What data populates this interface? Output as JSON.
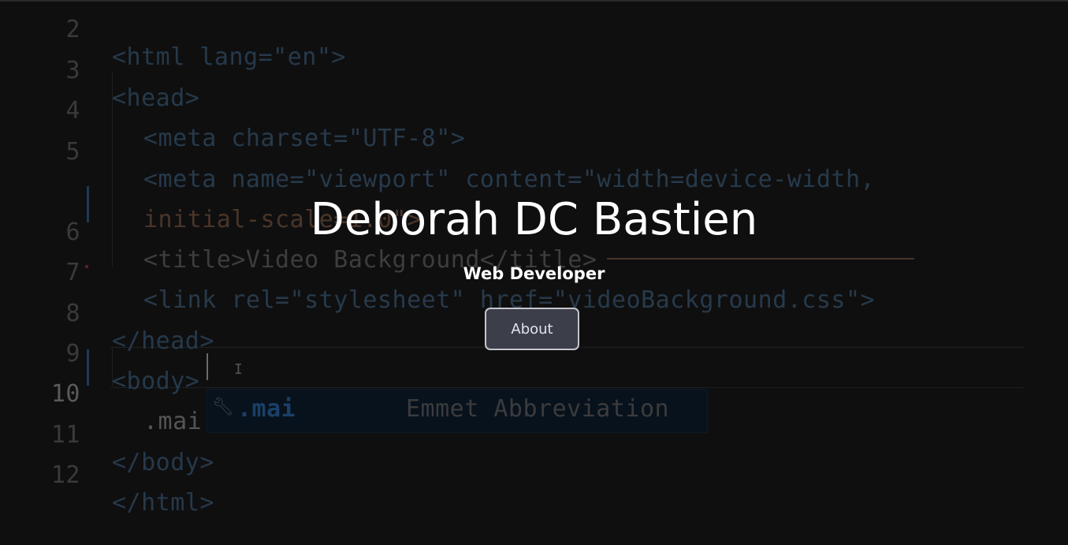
{
  "hero": {
    "title": "Deborah DC Bastien",
    "subtitle": "Web Developer",
    "button_label": "About"
  },
  "colors": {
    "accent_button_bg": "#3c3f4a",
    "accent_button_border": "#c4c5cc",
    "text": "#ffffff",
    "background": "#0f0f10"
  },
  "background_video": {
    "lines": [
      {
        "number": "2",
        "code": "<html lang=\"en\">"
      },
      {
        "number": "3",
        "code": "<head>"
      },
      {
        "number": "4",
        "code": "<meta charset=\"UTF-8\">"
      },
      {
        "number": "5",
        "code": "<meta name=\"viewport\" content=\"width=device-width,"
      },
      {
        "number": "",
        "code": "initial-scale=1.0\">"
      },
      {
        "number": "6",
        "code": "<title>Video Background</title>"
      },
      {
        "number": "7",
        "code": "<link rel=\"stylesheet\" href=\"videoBackground.css\">"
      },
      {
        "number": "8",
        "code": "</head>"
      },
      {
        "number": "9",
        "code": "<body>"
      },
      {
        "number": "10",
        "code": ".mai"
      },
      {
        "number": "11",
        "code": "</body>"
      },
      {
        "number": "12",
        "code": "</html>"
      }
    ],
    "suggestion": {
      "icon": "wrench-icon",
      "label": ".mai",
      "detail": "Emmet Abbreviation"
    }
  }
}
